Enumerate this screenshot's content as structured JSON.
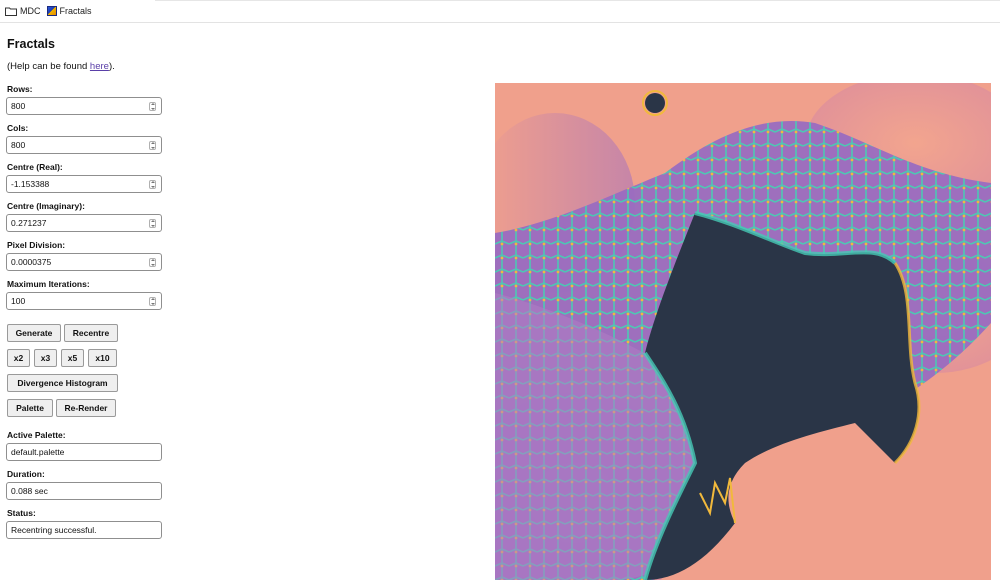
{
  "breadcrumb": {
    "items": [
      {
        "label": "MDC"
      },
      {
        "label": "Fractals"
      }
    ]
  },
  "page": {
    "title": "Fractals",
    "help_prefix": "(Help can be found ",
    "help_link": "here",
    "help_suffix": ")."
  },
  "form": {
    "rows": {
      "label": "Rows:",
      "value": "800"
    },
    "cols": {
      "label": "Cols:",
      "value": "800"
    },
    "centre_real": {
      "label": "Centre (Real):",
      "value": "-1.153388"
    },
    "centre_imag": {
      "label": "Centre (Imaginary):",
      "value": "0.271237"
    },
    "pixel_division": {
      "label": "Pixel Division:",
      "value": "0.0000375"
    },
    "max_iterations": {
      "label": "Maximum Iterations:",
      "value": "100"
    }
  },
  "buttons": {
    "generate": "Generate",
    "recentre": "Recentre",
    "x2": "x2",
    "x3": "x3",
    "x5": "x5",
    "x10": "x10",
    "histogram": "Divergence Histogram",
    "palette": "Palette",
    "rerender": "Re-Render"
  },
  "info": {
    "active_palette": {
      "label": "Active Palette:",
      "value": "default.palette"
    },
    "duration": {
      "label": "Duration:",
      "value": "0.088 sec"
    },
    "status": {
      "label": "Status:",
      "value": "Recentring successful."
    }
  },
  "colors": {
    "set_interior": "#2a3547",
    "outer": "#f0a08c",
    "mid": "#8a5aa8",
    "edge": "#3ec0b0",
    "highlight": "#f0b43a"
  }
}
